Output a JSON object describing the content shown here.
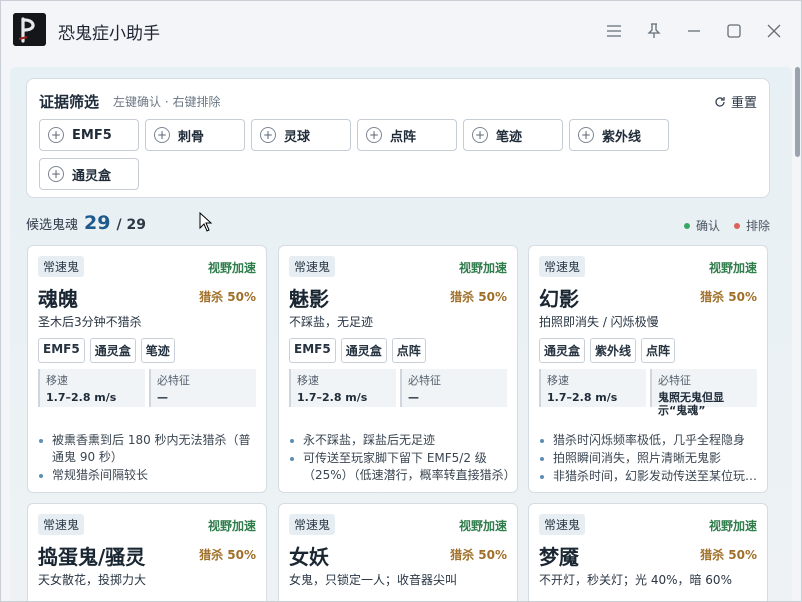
{
  "app": {
    "title": "恐鬼症小助手"
  },
  "filter": {
    "title": "证据筛选",
    "hint": "左键确认 · 右键排除",
    "reset": "重置",
    "chips": [
      "EMF5",
      "刺骨",
      "灵球",
      "点阵",
      "笔迹",
      "紫外线",
      "通灵盒"
    ]
  },
  "candidates": {
    "label": "候选鬼魂",
    "count": "29",
    "total": "/ 29"
  },
  "legend": {
    "confirm": "确认",
    "exclude": "排除",
    "confirm_color": "#3aa865",
    "exclude_color": "#d9645c"
  },
  "cards": [
    {
      "speed": "常速鬼",
      "type": "视野加速",
      "name": "魂魄",
      "hunt": "猎杀 50%",
      "desc": "圣木后3分钟不猎杀",
      "evidence": [
        "EMF5",
        "通灵盒",
        "笔迹"
      ],
      "stat1_k": "移速",
      "stat1_v": "1.7–2.8 m/s",
      "stat2_k": "必特征",
      "stat2_v": "—",
      "notes": [
        "被熏香熏到后 180 秒内无法猎杀（普通鬼 90 秒）",
        "常规猎杀间隔较长"
      ]
    },
    {
      "speed": "常速鬼",
      "type": "视野加速",
      "name": "魅影",
      "hunt": "猎杀 50%",
      "desc": "不踩盐，无足迹",
      "evidence": [
        "EMF5",
        "通灵盒",
        "点阵"
      ],
      "stat1_k": "移速",
      "stat1_v": "1.7–2.8 m/s",
      "stat2_k": "必特征",
      "stat2_v": "—",
      "notes": [
        "永不踩盐，踩盐后无足迹",
        "可传送至玩家脚下留下 EMF5/2 级（25%）（低速潜行，概率转直接猎杀）"
      ]
    },
    {
      "speed": "常速鬼",
      "type": "视野加速",
      "name": "幻影",
      "hunt": "猎杀 50%",
      "desc": "拍照即消失 / 闪烁极慢",
      "evidence": [
        "通灵盒",
        "紫外线",
        "点阵"
      ],
      "stat1_k": "移速",
      "stat1_v": "1.7–2.8 m/s",
      "stat2_k": "必特征",
      "stat2_v": "鬼照无鬼但显示“鬼魂”",
      "notes": [
        "猎杀时闪烁频率极低，几乎全程隐身",
        "拍照瞬间消失，照片清晰无鬼影",
        "非猎杀时间，幻影发动传送至某位玩家附近"
      ]
    },
    {
      "speed": "常速鬼",
      "type": "视野加速",
      "name": "捣蛋鬼/骚灵",
      "hunt": "猎杀 50%",
      "desc": "天女散花，投掷力大"
    },
    {
      "speed": "常速鬼",
      "type": "视野加速",
      "name": "女妖",
      "hunt": "猎杀 50%",
      "desc": "女鬼，只锁定一人；收音器尖叫"
    },
    {
      "speed": "常速鬼",
      "type": "视野加速",
      "name": "梦魇",
      "hunt": "猎杀 50%",
      "desc": "不开灯，秒关灯；光 40%，暗 60%"
    }
  ]
}
